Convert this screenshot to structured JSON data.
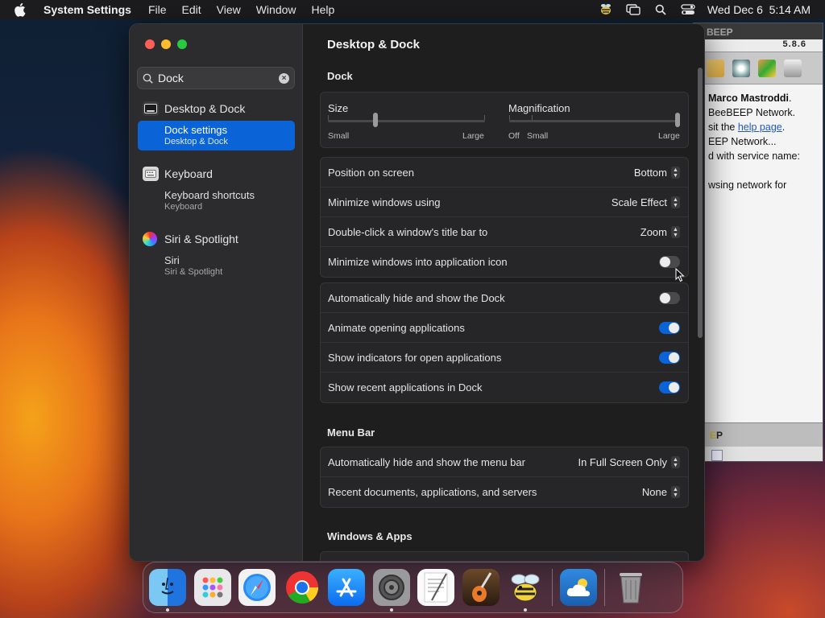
{
  "menubar": {
    "app_name": "System Settings",
    "menus": [
      "File",
      "Edit",
      "View",
      "Window",
      "Help"
    ],
    "clock": "Wed Dec 6  5:14 AM"
  },
  "beebeep": {
    "title": "BEEP",
    "version": "5.8.6",
    "lines": [
      {
        "pre": "",
        "bold": "Marco Mastroddi",
        "post": "."
      },
      {
        "pre": "BeeBEEP Network.",
        "bold": "",
        "post": ""
      },
      {
        "pre": "sit the ",
        "link": "help page",
        "post": "."
      },
      {
        "pre": "EEP Network...",
        "bold": "",
        "post": ""
      },
      {
        "pre": "d with service name:",
        "bold": "",
        "post": ""
      },
      {
        "pre": "",
        "bold": "",
        "post": ""
      },
      {
        "pre": "wsing network for",
        "bold": "",
        "post": ""
      }
    ],
    "status_e": "E",
    "status_p": "P"
  },
  "sidebar": {
    "search_value": "Dock",
    "groups": [
      {
        "title": "Desktop & Dock",
        "icon": "desktop-dock-icon",
        "sub_title": "Dock settings",
        "sub_caption": "Desktop & Dock",
        "selected": true
      },
      {
        "title": "Keyboard",
        "icon": "keyboard-icon",
        "sub_title": "Keyboard shortcuts",
        "sub_caption": "Keyboard",
        "selected": false
      },
      {
        "title": "Siri & Spotlight",
        "icon": "siri-icon",
        "sub_title": "Siri",
        "sub_caption": "Siri & Spotlight",
        "selected": false
      }
    ]
  },
  "main": {
    "title": "Desktop & Dock",
    "dock_section": "Dock",
    "size": {
      "label": "Size",
      "min": "Small",
      "max": "Large",
      "value": 0.3
    },
    "magnification": {
      "label": "Magnification",
      "off": "Off",
      "min": "Small",
      "max": "Large",
      "value": 1.0
    },
    "popups": [
      {
        "label": "Position on screen",
        "value": "Bottom"
      },
      {
        "label": "Minimize windows using",
        "value": "Scale Effect"
      },
      {
        "label": "Double-click a window's title bar to",
        "value": "Zoom"
      }
    ],
    "minimize_into_icon": {
      "label": "Minimize windows into application icon",
      "on": false
    },
    "toggles": [
      {
        "label": "Automatically hide and show the Dock",
        "on": false
      },
      {
        "label": "Animate opening applications",
        "on": true
      },
      {
        "label": "Show indicators for open applications",
        "on": true
      },
      {
        "label": "Show recent applications in Dock",
        "on": true
      }
    ],
    "menubar_section": "Menu Bar",
    "menubar_rows": [
      {
        "label": "Automatically hide and show the menu bar",
        "value": "In Full Screen Only"
      },
      {
        "label": "Recent documents, applications, and servers",
        "value": "None"
      }
    ],
    "windows_section": "Windows & Apps"
  },
  "colors": {
    "accent": "#0a64d8",
    "window_bg": "#1e1e1e",
    "sidebar_bg": "#2c2c2e"
  },
  "dock": {
    "apps": [
      "finder-icon",
      "launchpad-icon",
      "safari-icon",
      "chrome-icon",
      "app-store-icon",
      "system-settings-icon",
      "textedit-icon",
      "garageband-icon",
      "beebeep-icon"
    ],
    "recent": [
      "weather-icon"
    ],
    "trash": "trash-icon"
  }
}
